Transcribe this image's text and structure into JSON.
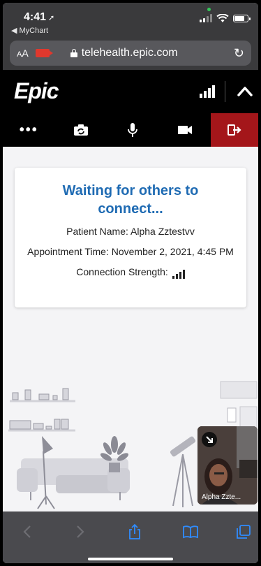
{
  "status_bar": {
    "time": "4:41",
    "back_app": "◀ MyChart"
  },
  "safari": {
    "aa": "AA",
    "url": "telehealth.epic.com"
  },
  "epic": {
    "logo": "Epic",
    "toolbar": [
      "more-options",
      "switch-camera",
      "microphone",
      "camera",
      "leave-visit"
    ]
  },
  "waiting_card": {
    "title": "Waiting for others to connect...",
    "patient_label": "Patient Name:",
    "patient_name": "Alpha Zztestvv",
    "appt_label": "Appointment Time:",
    "appt_time": "November 2, 2021, 4:45 PM",
    "conn_label": "Connection Strength:"
  },
  "self_view": {
    "name": "Alpha Zzte..."
  },
  "colors": {
    "accent": "#1f6bb3",
    "leave": "#a4161a",
    "header": "#000000"
  }
}
